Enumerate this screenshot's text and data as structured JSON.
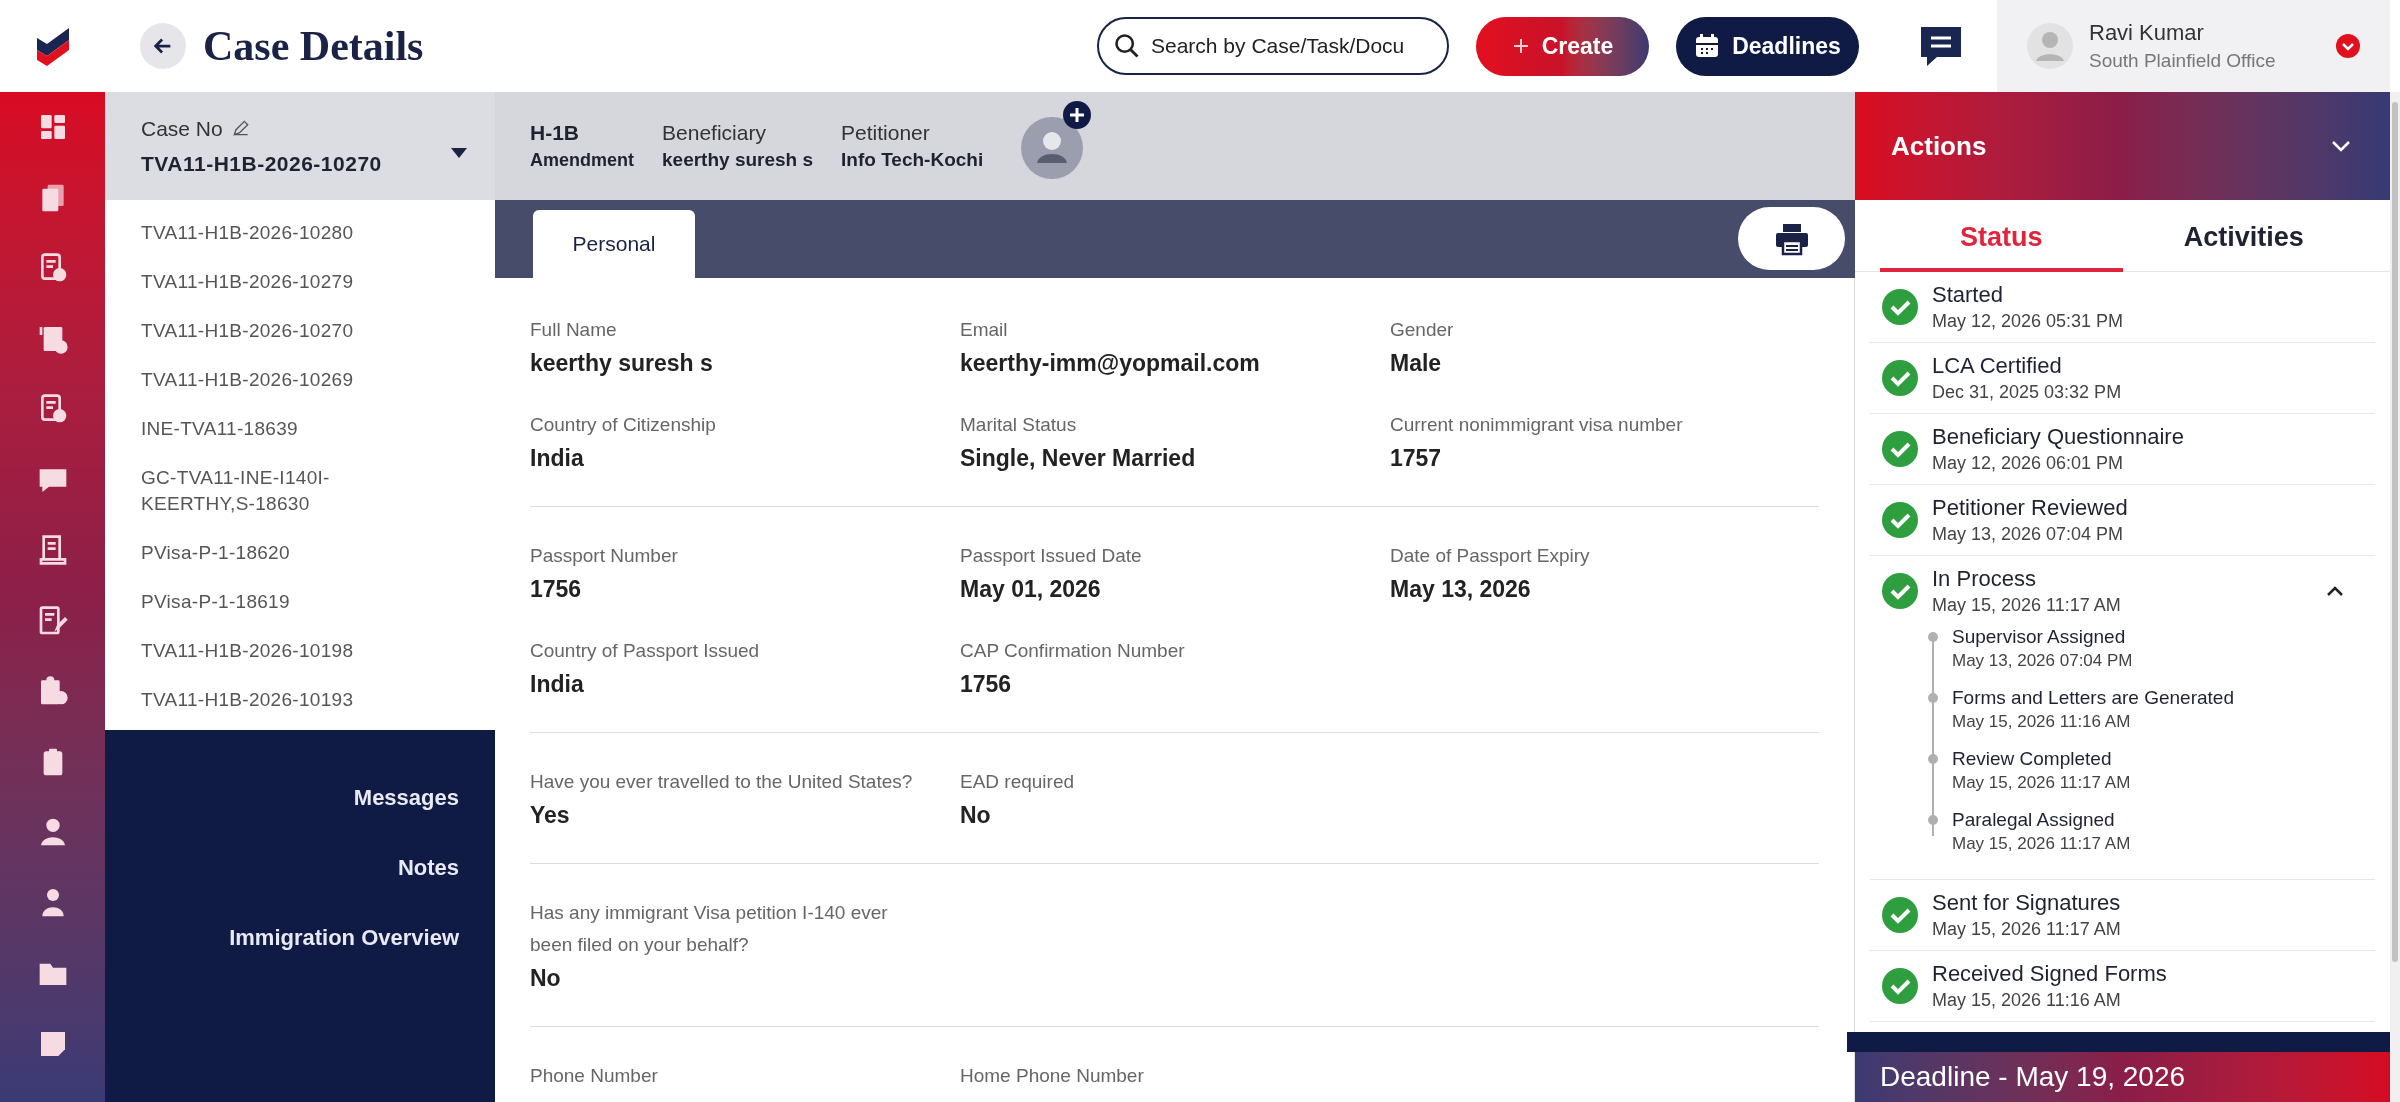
{
  "header": {
    "title": "Case Details",
    "search": {
      "placeholder": "Search by Case/Task/Docu"
    },
    "buttons": [
      {
        "label": "Create",
        "kind": "create"
      },
      {
        "label": "Deadlines",
        "kind": "deadlines"
      }
    ],
    "user": {
      "name": "Ravi Kumar",
      "office": "South Plainfield Office"
    }
  },
  "case": {
    "label": "Case No",
    "number": "TVA11-H1B-2026-10270",
    "expanded": true,
    "options": [
      "TVA11-H1B-2026-10280",
      "TVA11-H1B-2026-10279",
      "TVA11-H1B-2026-10270",
      "TVA11-H1B-2026-10269",
      "INE-TVA11-18639",
      "GC-TVA11-INE-I140I-KEERTHY,S-18630",
      "PVisa-P-1-18620",
      "PVisa-P-1-18619",
      "TVA11-H1B-2026-10198",
      "TVA11-H1B-2026-10193"
    ]
  },
  "left_nav": [
    "Messages",
    "Notes",
    "Immigration Overview"
  ],
  "case_info": {
    "type": "H-1B",
    "subtype": "Amendment",
    "fields": [
      {
        "label": "Beneficiary",
        "value": "keerthy suresh s"
      },
      {
        "label": "Petitioner",
        "value": "Info Tech-Kochi"
      }
    ]
  },
  "tabs": [
    {
      "label": "Personal",
      "selected": true
    }
  ],
  "sections": [
    [
      {
        "label": "Full Name",
        "value": "keerthy suresh s"
      },
      {
        "label": "Email",
        "value": "keerthy-imm@yopmail.com"
      },
      {
        "label": "Gender",
        "value": "Male"
      },
      {
        "label": "Country of Citizenship",
        "value": "India"
      },
      {
        "label": "Marital Status",
        "value": "Single, Never Married"
      },
      {
        "label": "Current nonimmigrant visa number",
        "value": "1757"
      }
    ],
    [
      {
        "label": "Passport Number",
        "value": "1756"
      },
      {
        "label": "Passport Issued Date",
        "value": "May 01, 2026"
      },
      {
        "label": "Date of Passport Expiry",
        "value": "May 13, 2026"
      },
      {
        "label": "Country of Passport Issued",
        "value": "India"
      },
      {
        "label": "CAP Confirmation Number",
        "value": "1756"
      }
    ],
    [
      {
        "label": "Have you ever travelled to the United States?",
        "value": "Yes"
      },
      {
        "label": "EAD required",
        "value": "No"
      }
    ],
    [
      {
        "label": "Has any immigrant Visa petition I-140 ever been filed on your behalf?",
        "value": "No"
      }
    ],
    [
      {
        "label": "Phone Number"
      },
      {
        "label": "Home Phone Number"
      }
    ]
  ],
  "actions": {
    "title": "Actions",
    "tabs": [
      {
        "label": "Status",
        "selected": true
      },
      {
        "label": "Activities",
        "selected": false
      }
    ],
    "steps": [
      {
        "title": "Started",
        "time": "May 12, 2026 05:31 PM",
        "done": true
      },
      {
        "title": "LCA Certified",
        "time": "Dec 31, 2025 03:32 PM",
        "done": true
      },
      {
        "title": "Beneficiary Questionnaire",
        "time": "May 12, 2026 06:01 PM",
        "done": true
      },
      {
        "title": "Petitioner Reviewed",
        "time": "May 13, 2026 07:04 PM",
        "done": true
      },
      {
        "title": "In Process",
        "time": "May 15, 2026 11:17 AM",
        "done": true,
        "expanded": true,
        "children": [
          {
            "title": "Supervisor Assigned",
            "time": "May 13, 2026 07:04 PM"
          },
          {
            "title": "Forms and Letters are Generated",
            "time": "May 15, 2026 11:16 AM"
          },
          {
            "title": "Review Completed",
            "time": "May 15, 2026 11:17 AM"
          },
          {
            "title": "Paralegal Assigned",
            "time": "May 15, 2026 11:17 AM"
          }
        ]
      },
      {
        "title": "Sent for Signatures",
        "time": "May 15, 2026 11:17 AM",
        "done": true
      },
      {
        "title": "Received Signed Forms",
        "time": "May 15, 2026 11:16 AM",
        "done": true
      }
    ]
  },
  "deadline": "Deadline - May 19, 2026"
}
